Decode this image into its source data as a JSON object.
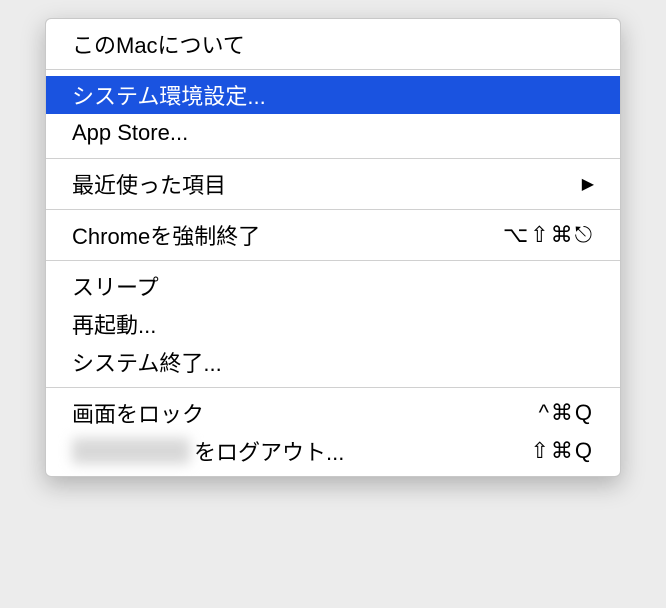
{
  "menu": {
    "items": [
      {
        "label": "このMacについて",
        "shortcut": "",
        "arrow": false
      },
      {
        "separator": true
      },
      {
        "label": "システム環境設定...",
        "shortcut": "",
        "arrow": false,
        "highlighted": true
      },
      {
        "label": "App Store...",
        "shortcut": "",
        "arrow": false
      },
      {
        "separator": true
      },
      {
        "label": "最近使った項目",
        "shortcut": "",
        "arrow": true
      },
      {
        "separator": true
      },
      {
        "label": "Chromeを強制終了",
        "shortcut": "⌥⇧⌘⎋",
        "arrow": false
      },
      {
        "separator": true
      },
      {
        "label": "スリープ",
        "shortcut": "",
        "arrow": false
      },
      {
        "label": "再起動...",
        "shortcut": "",
        "arrow": false
      },
      {
        "label": "システム終了...",
        "shortcut": "",
        "arrow": false
      },
      {
        "separator": true
      },
      {
        "label": "画面をロック",
        "shortcut": "^⌘Q",
        "arrow": false
      },
      {
        "label_prefix_hidden": "xxxxxxxxxx",
        "label_suffix": "をログアウト...",
        "shortcut": "⇧⌘Q",
        "arrow": false
      }
    ]
  }
}
